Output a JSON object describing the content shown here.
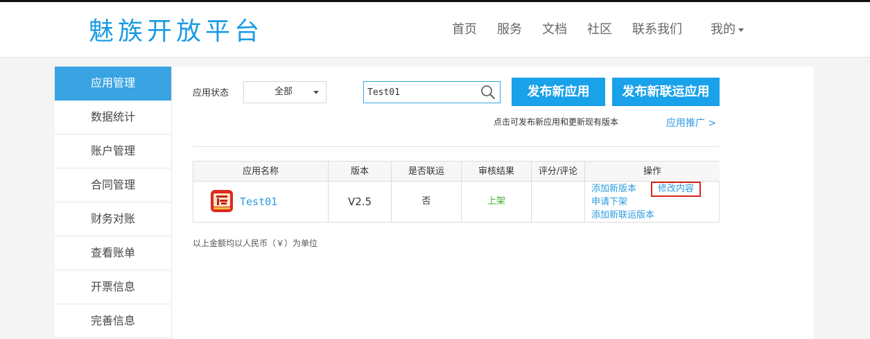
{
  "header": {
    "logo": "魅族开放平台",
    "nav": [
      "首页",
      "服务",
      "文档",
      "社区",
      "联系我们"
    ],
    "mine": "我的"
  },
  "sidebar": {
    "items": [
      "应用管理",
      "数据统计",
      "账户管理",
      "合同管理",
      "财务对账",
      "查看账单",
      "开票信息",
      "完善信息"
    ],
    "active": "应用管理"
  },
  "filters": {
    "status_label": "应用状态",
    "status_value": "全部",
    "search_value": "Test01"
  },
  "actions": {
    "publish_new": "发布新应用",
    "publish_joint": "发布新联运应用",
    "hint": "点击可发布新应用和更新现有版本",
    "promo": "应用推广 >"
  },
  "table": {
    "headers": [
      "应用名称",
      "版本",
      "是否联运",
      "审核结果",
      "评分/评论",
      "操作"
    ],
    "rows": [
      {
        "name": "Test01",
        "version": "V2.5",
        "joint": "否",
        "review": "上架",
        "rating": "",
        "ops": [
          "添加新版本",
          "修改内容",
          "申请下架",
          "添加新联运版本"
        ]
      }
    ]
  },
  "footnote": "以上金额均以人民币（￥）为单位",
  "colors": {
    "accent": "#19a1ea",
    "link": "#2a9ae0",
    "status_on": "#3bb027",
    "highlight": "#d9231d",
    "app_icon": "#e0281f"
  },
  "icons": {
    "search": "search-icon",
    "app": "app-icon"
  }
}
